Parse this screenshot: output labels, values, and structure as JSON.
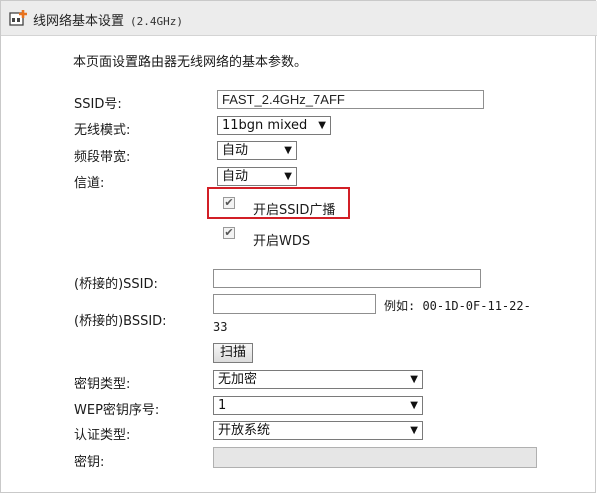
{
  "header": {
    "title": "线网络基本设置",
    "band": "(2.4GHz)"
  },
  "description": "本页面设置路由器无线网络的基本参数。",
  "form": {
    "ssid": {
      "label": "SSID号:",
      "value": "FAST_2.4GHz_7AFF"
    },
    "mode": {
      "label": "无线模式:",
      "value": "11bgn mixed"
    },
    "bandwidth": {
      "label": "频段带宽:",
      "value": "自动"
    },
    "channel": {
      "label": "信道:",
      "value": "自动"
    },
    "ssid_broadcast": {
      "label": "开启SSID广播",
      "checked": true
    },
    "wds": {
      "label": "开启WDS",
      "checked": true
    },
    "bridge_ssid": {
      "label": "(桥接的)SSID:",
      "value": ""
    },
    "bridge_bssid": {
      "label": "(桥接的)BSSID:",
      "value": "",
      "example_line1": "例如: 00-1D-0F-11-22-",
      "example_line2": "33"
    },
    "scan_button": "扫描",
    "key_type": {
      "label": "密钥类型:",
      "value": "无加密"
    },
    "wep_index": {
      "label": "WEP密钥序号:",
      "value": "1"
    },
    "auth_type": {
      "label": "认证类型:",
      "value": "开放系统"
    },
    "key": {
      "label": "密钥:",
      "value": ""
    }
  },
  "icons": {
    "logo": "router-settings-icon",
    "check": "checkmark-icon",
    "arrow": "dropdown-arrow-icon"
  },
  "colors": {
    "highlight": "#d21f26",
    "header_bg": "#ececec",
    "logo_accent": "#e8731f"
  }
}
